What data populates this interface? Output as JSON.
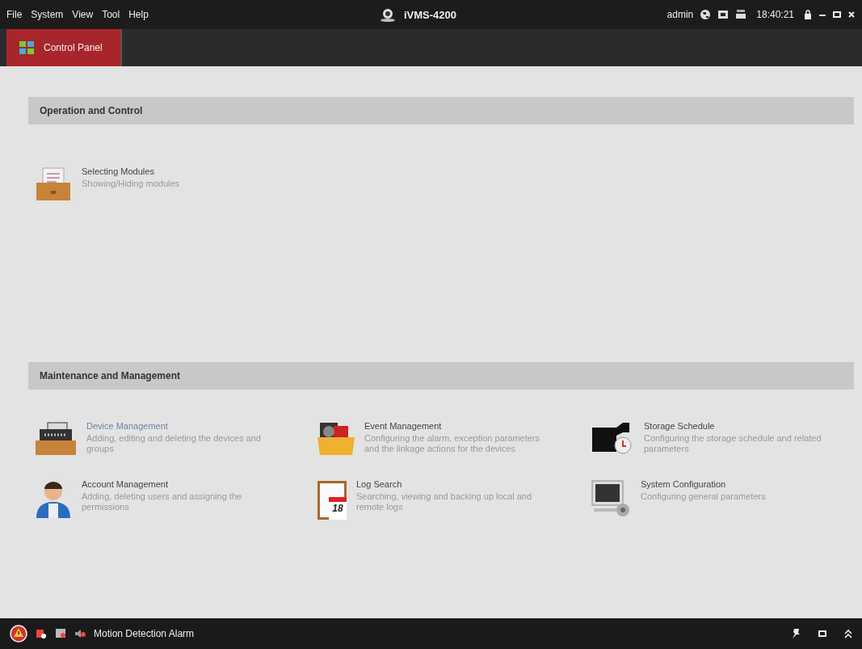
{
  "menu": [
    "File",
    "System",
    "View",
    "Tool",
    "Help"
  ],
  "window": {
    "title": "iVMS-4200"
  },
  "status": {
    "user": "admin",
    "time": "18:40:21"
  },
  "tabs": [
    {
      "label": "Control Panel",
      "selected": true
    }
  ],
  "sections": [
    {
      "title": "Operation and Control",
      "modules": [
        {
          "kind": "modules",
          "title": "Selecting Modules",
          "desc": "Showing/Hiding modules",
          "selected": false
        }
      ]
    },
    {
      "title": "Maintenance and Management",
      "modules": [
        {
          "kind": "device",
          "title": "Device Management",
          "desc": "Adding, editing and deleting the devices and groups",
          "selected": true
        },
        {
          "kind": "event",
          "title": "Event Management",
          "desc": "Configuring the alarm, exception parameters and the linkage actions for the devices",
          "selected": false
        },
        {
          "kind": "storage",
          "title": "Storage Schedule",
          "desc": "Configuring the storage schedule and related parameters",
          "selected": false
        },
        {
          "kind": "account",
          "title": "Account Management",
          "desc": "Adding, deleting users and assigning the permissions",
          "selected": false
        },
        {
          "kind": "log",
          "title": "Log Search",
          "desc": "Searching, viewing and backing up local and remote logs",
          "selected": false,
          "day": "18"
        },
        {
          "kind": "system",
          "title": "System Configuration",
          "desc": "Configuring general parameters",
          "selected": false
        }
      ]
    }
  ],
  "footer": {
    "alarm": "Motion Detection Alarm"
  }
}
